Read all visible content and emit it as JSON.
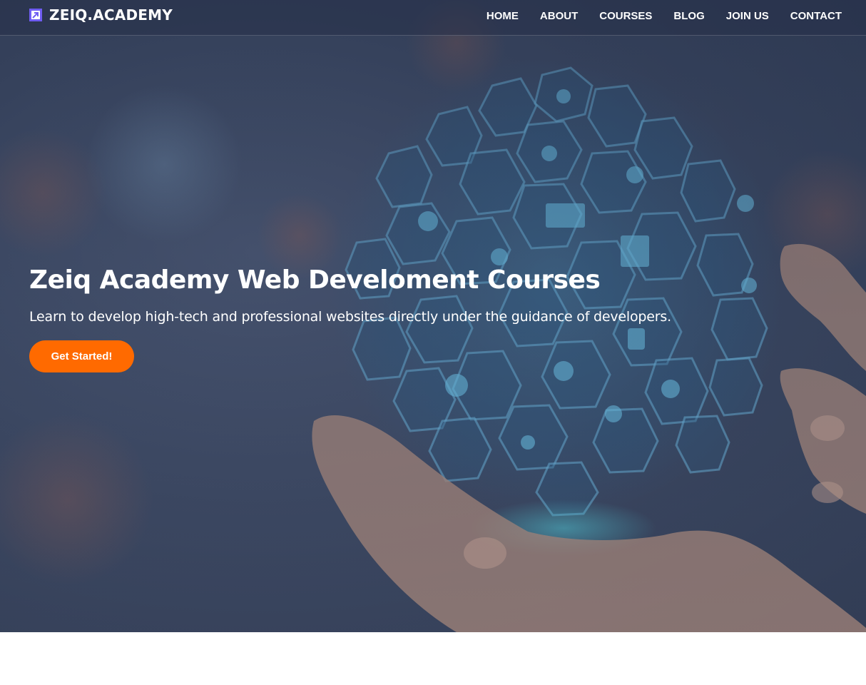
{
  "brand": {
    "name": "ZEIQ.ACADEMY",
    "logo_icon": "logo-square-icon",
    "accent": "#6f5cf2"
  },
  "nav": {
    "items": [
      {
        "label": "HOME"
      },
      {
        "label": "ABOUT"
      },
      {
        "label": "COURSES"
      },
      {
        "label": "BLOG"
      },
      {
        "label": "JOIN US"
      },
      {
        "label": "CONTACT"
      }
    ]
  },
  "hero": {
    "title": "Zeiq Academy Web Develoment Courses",
    "subtitle": "Learn to develop high-tech and professional websites directly under the guidance of developers.",
    "cta_label": "Get Started!",
    "cta_color": "#ff6a00",
    "background_image": "hand-holding-glowing-globe-of-icons"
  }
}
